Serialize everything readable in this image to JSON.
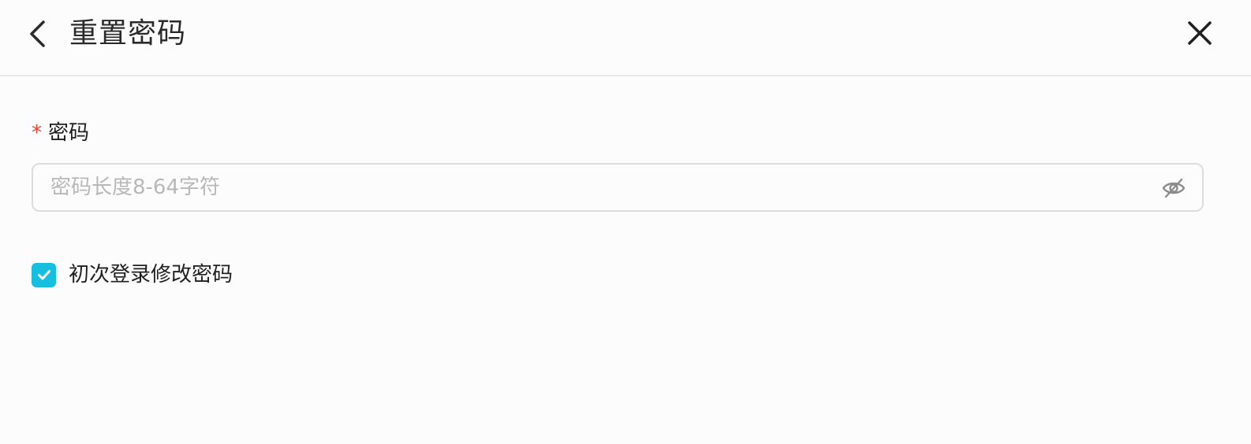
{
  "header": {
    "title": "重置密码",
    "back_icon": "chevron-left-icon",
    "close_icon": "close-icon"
  },
  "form": {
    "password": {
      "required_mark": "*",
      "label": "密码",
      "value": "",
      "placeholder": "密码长度8-64字符",
      "toggle_icon": "eye-off-icon"
    },
    "first_login_change": {
      "label": "初次登录修改密码",
      "checked": true
    }
  },
  "colors": {
    "accent": "#16bfe0",
    "required": "#f04134",
    "border": "#dcdcdc",
    "placeholder": "#b8b8b8"
  }
}
